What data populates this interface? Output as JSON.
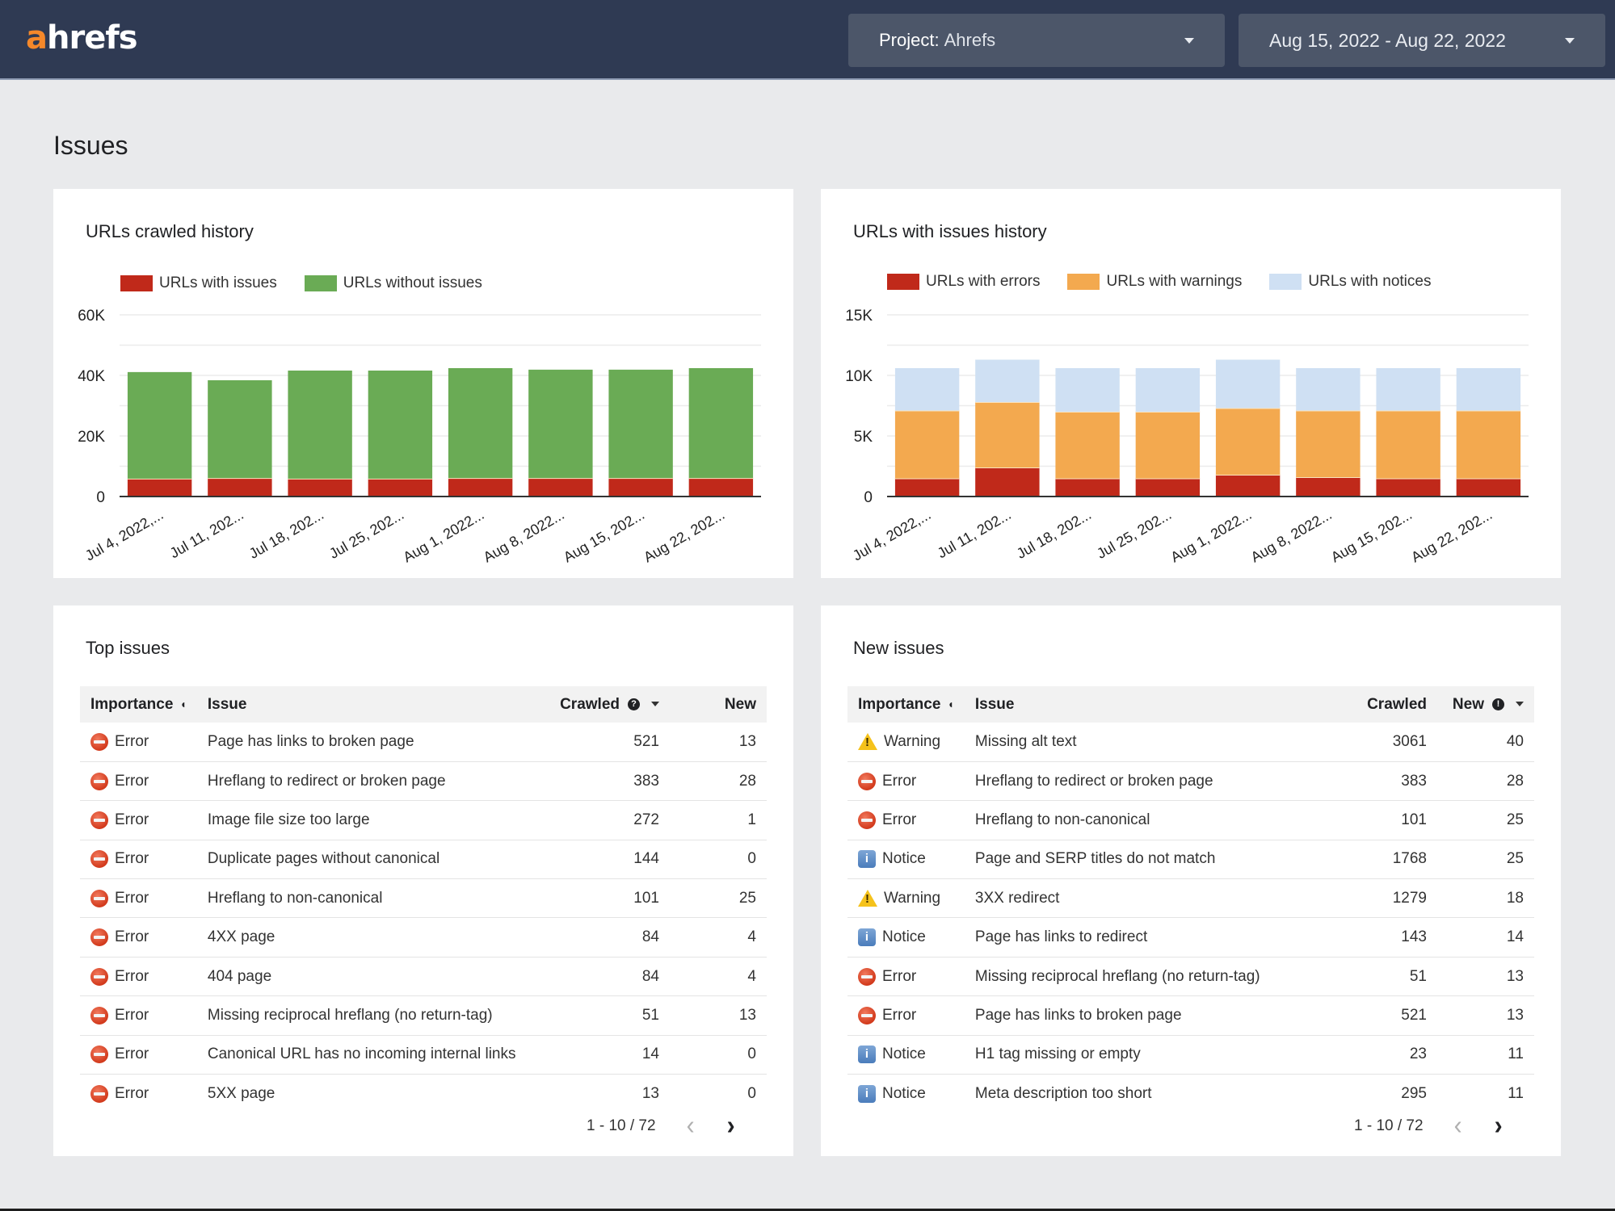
{
  "header": {
    "logo_accent": "a",
    "logo_rest": "hrefs",
    "project_label": "Project:",
    "project_value": "Ahrefs",
    "date_range": "Aug 15, 2022 - Aug 22, 2022"
  },
  "page": {
    "title": "Issues"
  },
  "colors": {
    "brand_orange": "#f5882a",
    "header_bg": "#2f3a53",
    "issues_red": "#c0291a",
    "no_issues_green": "#6aab55",
    "warnings_orange": "#f3a94f",
    "notices_blue": "#cfe0f3"
  },
  "chart_data": [
    {
      "type": "bar",
      "stacked": true,
      "title": "URLs crawled history",
      "categories": [
        "Jul 4, 2022,...",
        "Jul 11, 202...",
        "Jul 18, 202...",
        "Jul 25, 202...",
        "Aug 1, 2022...",
        "Aug 8, 2022...",
        "Aug 15, 202...",
        "Aug 22, 202..."
      ],
      "series": [
        {
          "name": "URLs with issues",
          "color": "#c0291a",
          "values": [
            5900,
            6100,
            5900,
            5900,
            6100,
            6100,
            6100,
            6100
          ]
        },
        {
          "name": "URLs without issues",
          "color": "#6aab55",
          "values": [
            35200,
            32300,
            35700,
            35700,
            36300,
            35800,
            35800,
            36300
          ]
        }
      ],
      "yticks": [
        "0",
        "20K",
        "40K",
        "60K"
      ],
      "ylim": [
        0,
        60000
      ],
      "ytick_step": 20000,
      "grid": true,
      "legend": "top-left",
      "xlabel": "",
      "ylabel": ""
    },
    {
      "type": "bar",
      "stacked": true,
      "title": "URLs with issues history",
      "categories": [
        "Jul 4, 2022,...",
        "Jul 11, 202...",
        "Jul 18, 202...",
        "Jul 25, 202...",
        "Aug 1, 2022...",
        "Aug 8, 2022...",
        "Aug 15, 202...",
        "Aug 22, 202..."
      ],
      "series": [
        {
          "name": "URLs with errors",
          "color": "#c0291a",
          "values": [
            1500,
            2400,
            1500,
            1500,
            1800,
            1600,
            1500,
            1500
          ]
        },
        {
          "name": "URLs with warnings",
          "color": "#f3a94f",
          "values": [
            5600,
            5400,
            5500,
            5500,
            5500,
            5500,
            5600,
            5600
          ]
        },
        {
          "name": "URLs with notices",
          "color": "#cfe0f3",
          "values": [
            3500,
            3500,
            3600,
            3600,
            4000,
            3500,
            3500,
            3500
          ]
        }
      ],
      "yticks": [
        "0",
        "5K",
        "10K",
        "15K"
      ],
      "ylim": [
        0,
        15000
      ],
      "ytick_step": 5000,
      "grid": true,
      "legend": "top-left",
      "xlabel": "",
      "ylabel": ""
    }
  ],
  "top_issues": {
    "title": "Top issues",
    "columns": {
      "importance": "Importance",
      "issue": "Issue",
      "crawled": "Crawled",
      "new": "New"
    },
    "rows": [
      {
        "importance": "Error",
        "icon": "error",
        "issue": "Page has links to broken page",
        "crawled": "521",
        "new": "13"
      },
      {
        "importance": "Error",
        "icon": "error",
        "issue": "Hreflang to redirect or broken page",
        "crawled": "383",
        "new": "28"
      },
      {
        "importance": "Error",
        "icon": "error",
        "issue": "Image file size too large",
        "crawled": "272",
        "new": "1"
      },
      {
        "importance": "Error",
        "icon": "error",
        "issue": "Duplicate pages without canonical",
        "crawled": "144",
        "new": "0"
      },
      {
        "importance": "Error",
        "icon": "error",
        "issue": "Hreflang to non-canonical",
        "crawled": "101",
        "new": "25"
      },
      {
        "importance": "Error",
        "icon": "error",
        "issue": "4XX page",
        "crawled": "84",
        "new": "4"
      },
      {
        "importance": "Error",
        "icon": "error",
        "issue": "404 page",
        "crawled": "84",
        "new": "4"
      },
      {
        "importance": "Error",
        "icon": "error",
        "issue": "Missing reciprocal hreflang (no return-tag)",
        "crawled": "51",
        "new": "13"
      },
      {
        "importance": "Error",
        "icon": "error",
        "issue": "Canonical URL has no incoming internal links",
        "crawled": "14",
        "new": "0"
      },
      {
        "importance": "Error",
        "icon": "error",
        "issue": "5XX page",
        "crawled": "13",
        "new": "0"
      }
    ],
    "pagination": "1 - 10 / 72"
  },
  "new_issues": {
    "title": "New issues",
    "columns": {
      "importance": "Importance",
      "issue": "Issue",
      "crawled": "Crawled",
      "new": "New"
    },
    "rows": [
      {
        "importance": "Warning",
        "icon": "warning",
        "issue": "Missing alt text",
        "crawled": "3061",
        "new": "40"
      },
      {
        "importance": "Error",
        "icon": "error",
        "issue": "Hreflang to redirect or broken page",
        "crawled": "383",
        "new": "28"
      },
      {
        "importance": "Error",
        "icon": "error",
        "issue": "Hreflang to non-canonical",
        "crawled": "101",
        "new": "25"
      },
      {
        "importance": "Notice",
        "icon": "notice",
        "issue": "Page and SERP titles do not match",
        "crawled": "1768",
        "new": "25"
      },
      {
        "importance": "Warning",
        "icon": "warning",
        "issue": "3XX redirect",
        "crawled": "1279",
        "new": "18"
      },
      {
        "importance": "Notice",
        "icon": "notice",
        "issue": "Page has links to redirect",
        "crawled": "143",
        "new": "14"
      },
      {
        "importance": "Error",
        "icon": "error",
        "issue": "Missing reciprocal hreflang (no return-tag)",
        "crawled": "51",
        "new": "13"
      },
      {
        "importance": "Error",
        "icon": "error",
        "issue": "Page has links to broken page",
        "crawled": "521",
        "new": "13"
      },
      {
        "importance": "Notice",
        "icon": "notice",
        "issue": "H1 tag missing or empty",
        "crawled": "23",
        "new": "11"
      },
      {
        "importance": "Notice",
        "icon": "notice",
        "issue": "Meta description too short",
        "crawled": "295",
        "new": "11"
      }
    ],
    "pagination": "1 - 10 / 72"
  }
}
